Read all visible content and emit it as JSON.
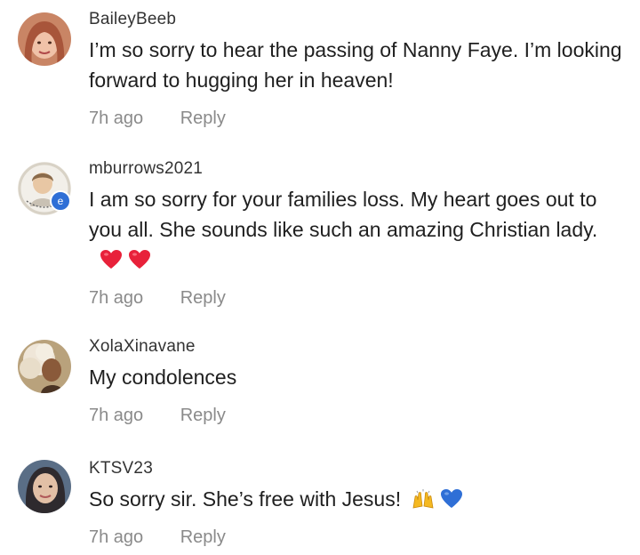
{
  "comments": [
    {
      "username": "BaileyBeeb",
      "text": "I’m so sorry to hear the passing of Nanny Faye. I’m looking forward to hugging her in heaven!",
      "time": "7h ago",
      "reply": "Reply"
    },
    {
      "username": "mburrows2021",
      "text": "I am so sorry for your families loss. My heart goes out to you all. She sounds like such an amazing Christian lady.",
      "emoji": [
        "red-heart-icon",
        "red-heart-icon"
      ],
      "time": "7h ago",
      "reply": "Reply"
    },
    {
      "username": "XolaXinavane",
      "text": "My condolences",
      "time": "7h ago",
      "reply": "Reply"
    },
    {
      "username": "KTSV23",
      "text": "So sorry sir. She’s free with Jesus!",
      "emoji": [
        "raising-hands-icon",
        "blue-heart-icon"
      ],
      "time": "7h ago",
      "reply": "Reply"
    }
  ],
  "colors": {
    "username": "#333333",
    "text": "#1f1f1f",
    "meta": "#8a8a8a",
    "heart_red": "#e8213a",
    "heart_blue": "#2f6fd6",
    "hands_yellow": "#f5b921"
  }
}
